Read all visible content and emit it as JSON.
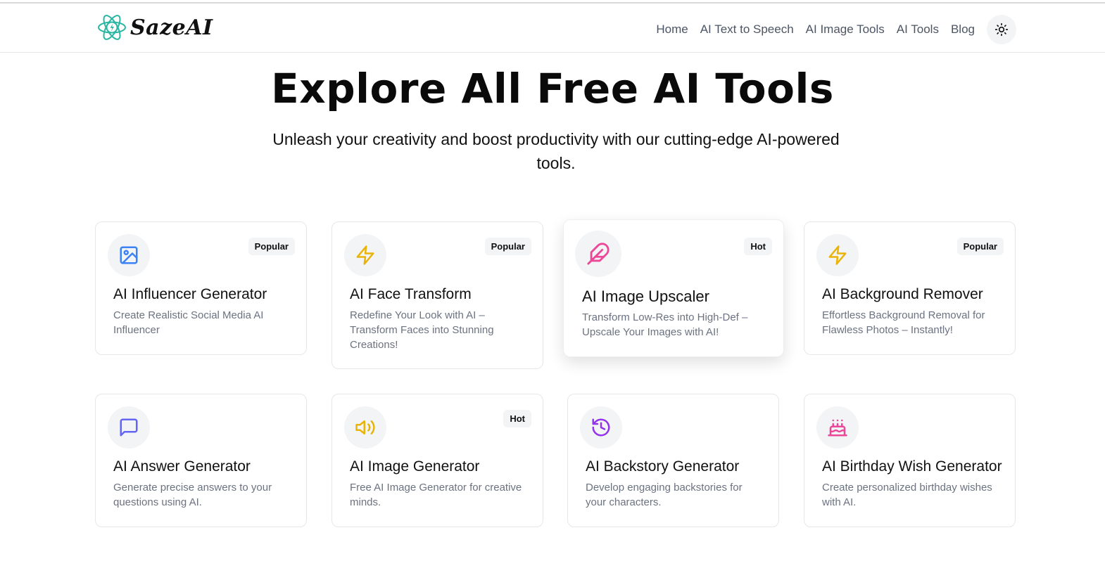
{
  "brand": {
    "name": "SazeAI",
    "accent": "#2ab6a2"
  },
  "nav": {
    "links": [
      "Home",
      "AI Text to Speech",
      "AI Image Tools",
      "AI Tools",
      "Blog"
    ],
    "theme_icon": "sun-icon"
  },
  "hero": {
    "title": "Explore All Free AI Tools",
    "subtitle": "Unleash your creativity and boost productivity with our cutting-edge AI-powered tools."
  },
  "tools": [
    {
      "title": "AI Influencer Generator",
      "description": "Create Realistic Social Media AI Influencer",
      "badge": "Popular",
      "icon": "image-icon",
      "icon_color": "#3b82f6"
    },
    {
      "title": "AI Face Transform",
      "description": "Redefine Your Look with AI – Transform Faces into Stunning Creations!",
      "badge": "Popular",
      "icon": "lightning-icon",
      "icon_color": "#eab308"
    },
    {
      "title": "AI Image Upscaler",
      "description": "Transform Low-Res into High-Def – Upscale Your Images with AI!",
      "badge": "Hot",
      "icon": "feather-icon",
      "icon_color": "#ec4899"
    },
    {
      "title": "AI Background Remover",
      "description": "Effortless Background Removal for Flawless Photos – Instantly!",
      "badge": "Popular",
      "icon": "lightning-icon",
      "icon_color": "#eab308"
    },
    {
      "title": "AI Answer Generator",
      "description": "Generate precise answers to your questions using AI.",
      "badge": "",
      "icon": "message-square-icon",
      "icon_color": "#6366f1"
    },
    {
      "title": "AI Image Generator",
      "description": "Free AI Image Generator for creative minds.",
      "badge": "Hot",
      "icon": "volume-icon",
      "icon_color": "#eab308"
    },
    {
      "title": "AI Backstory Generator",
      "description": "Develop engaging backstories for your characters.",
      "badge": "",
      "icon": "history-icon",
      "icon_color": "#9333ea"
    },
    {
      "title": "AI Birthday Wish Generator",
      "description": "Create personalized birthday wishes with AI.",
      "badge": "",
      "icon": "cake-icon",
      "icon_color": "#ec4899"
    }
  ]
}
